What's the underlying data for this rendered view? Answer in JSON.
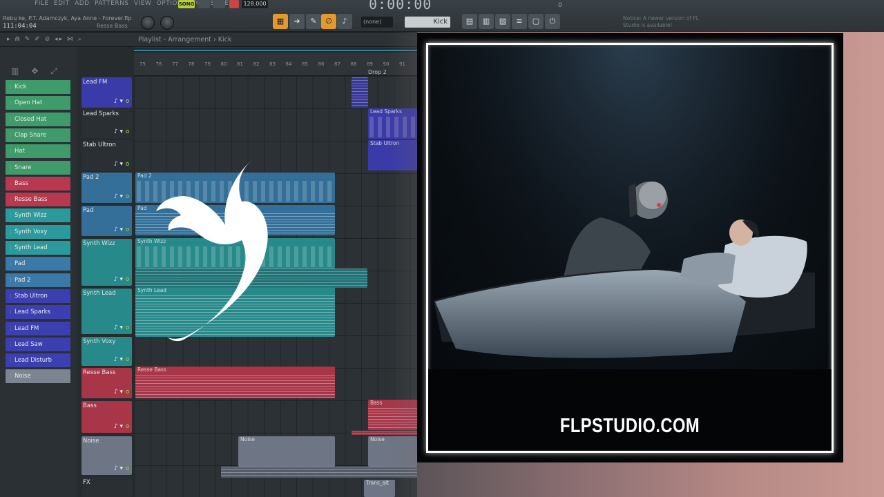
{
  "menu": [
    "FILE",
    "EDIT",
    "ADD",
    "PATTERNS",
    "VIEW",
    "OPTIONS",
    "TOOLS",
    "HELP"
  ],
  "song": {
    "title": "Rebu ke, P.T. Adamczyk, Aya Anne - Forever.flp",
    "position": "111:04:04",
    "channel": "Resse Bass"
  },
  "transport": {
    "mode": "SONG",
    "tempo": "128.000",
    "time": "0:00:00"
  },
  "toolbar": {
    "pattern": "(none)",
    "channel": "Kick",
    "counter": "0"
  },
  "notice": "Notice: A newer version of FL Studio is available!",
  "playlist": {
    "breadcrumb": "Playlist - Arrangement › Kick"
  },
  "ruler": {
    "ticks": [
      "75",
      "76",
      "77",
      "78",
      "79",
      "80",
      "81",
      "82",
      "83",
      "84",
      "85",
      "86",
      "87",
      "88",
      "89",
      "90",
      "91"
    ],
    "marker": "Drop 2"
  },
  "channels": [
    {
      "label": "Kick",
      "color": "#3f9b6a"
    },
    {
      "label": "Open Hat",
      "color": "#3f9b6a"
    },
    {
      "label": "Closed Hat",
      "color": "#3f9b6a"
    },
    {
      "label": "Clap Snare",
      "color": "#3f9b6a"
    },
    {
      "label": "Hat",
      "color": "#3f9b6a"
    },
    {
      "label": "Snare",
      "color": "#3f9b6a"
    },
    {
      "label": "Bass",
      "color": "#b8384f"
    },
    {
      "label": "Resse Bass",
      "color": "#b8384f"
    },
    {
      "label": "Synth Wizz",
      "color": "#2a9a9c"
    },
    {
      "label": "Synth Voxy",
      "color": "#2a9a9c"
    },
    {
      "label": "Synth Lead",
      "color": "#2a9a9c"
    },
    {
      "label": "Pad",
      "color": "#3a79a8"
    },
    {
      "label": "Pad 2",
      "color": "#3a79a8"
    },
    {
      "label": "Stab Ultron",
      "color": "#3c3fb0"
    },
    {
      "label": "Lead Sparks",
      "color": "#3c3fb0"
    },
    {
      "label": "Lead FM",
      "color": "#3c3fb0"
    },
    {
      "label": "Lead Saw",
      "color": "#3c3fb0"
    },
    {
      "label": "Lead Disturb",
      "color": "#3c3fb0"
    },
    {
      "label": "Noise",
      "color": "#7c8391"
    }
  ],
  "tracks": [
    {
      "label": "Lead FM",
      "color": "#3a3aa8"
    },
    {
      "label": "Lead Sparks",
      "color": "#2a2f33"
    },
    {
      "label": "Stab Ultron",
      "color": "#2a2f33"
    },
    {
      "label": "Pad 2",
      "color": "#336f98"
    },
    {
      "label": "Pad",
      "color": "#336f98"
    },
    {
      "label": "Synth Wizz",
      "color": "#27898a"
    },
    {
      "label": "Synth Lead",
      "color": "#27898a"
    },
    {
      "label": "Synth Voxy",
      "color": "#27898a"
    },
    {
      "label": "Resse Bass",
      "color": "#a93549"
    },
    {
      "label": "Bass",
      "color": "#a93549"
    },
    {
      "label": "Noise",
      "color": "#6e7584"
    },
    {
      "label": "FX",
      "color": "#2a2f33"
    }
  ],
  "clips": [
    {
      "label": "Pad 2",
      "color": "#336f98"
    },
    {
      "label": "Pad",
      "color": "#336f98"
    },
    {
      "label": "Synth Wizz",
      "color": "#27898a"
    },
    {
      "label": "Synth Lead",
      "color": "#27898a"
    },
    {
      "label": "Resse Bass",
      "color": "#a93549"
    },
    {
      "label": "Lead Sparks",
      "color": "#3a3aa8"
    },
    {
      "label": "Stab Ultron",
      "color": "#3a3aa8"
    },
    {
      "label": "Bass",
      "color": "#a93549"
    },
    {
      "label": "Noise",
      "color": "#6e7584"
    },
    {
      "label": "Noise",
      "color": "#6e7584"
    },
    {
      "label": "Trans_alt",
      "color": "#6e7584"
    }
  ],
  "art": {
    "brand": "FLPSTUDIO.COM"
  }
}
